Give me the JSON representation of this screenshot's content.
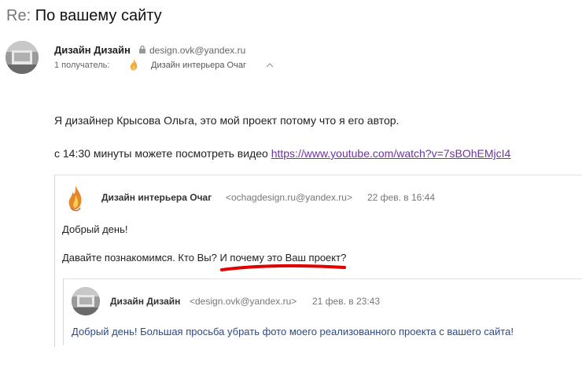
{
  "subject": {
    "prefix": "Re:",
    "text": "По вашему сайту"
  },
  "sender": {
    "name": "Дизайн Дизайн",
    "email": "design.ovk@yandex.ru",
    "avatar_icon": "avatar-photo",
    "lock_icon": "lock-icon"
  },
  "recipients": {
    "label": "1 получатель:",
    "name": "Дизайн интерьера Очаг",
    "icon": "flame-icon"
  },
  "message": {
    "line1": "Я дизайнер Крысова Ольга, это мой проект потому что я его автор.",
    "line2_prefix": "с 14:30 минуты можете посмотреть видео",
    "link": "https://www.youtube.com/watch?v=7sBOhEMjcI4"
  },
  "quote1": {
    "name": "Дизайн интерьера Очаг",
    "email": "<ochagdesign.ru@yandex.ru>",
    "date": "22 фев. в 16:44",
    "greeting": "Добрый день!",
    "question": "Давайте познакомимся. Кто Вы? И почему это Ваш проект?"
  },
  "quote2": {
    "name": "Дизайн Дизайн",
    "email": "<design.ovk@yandex.ru>",
    "date": "21 фев. в 23:43",
    "text": "Добрый день! Большая просьба убрать фото моего реализованного проекта с вашего сайта!"
  },
  "colors": {
    "link": "#6f32a3",
    "underline_mark": "#e00000",
    "quoted_text": "#2a4a8a"
  }
}
